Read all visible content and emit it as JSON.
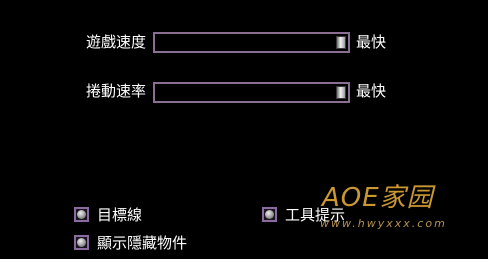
{
  "settings": {
    "game_speed": {
      "label": "遊戲速度",
      "value_label": "最快",
      "level": 1.0
    },
    "scroll_speed": {
      "label": "捲動速率",
      "value_label": "最快",
      "level": 1.0
    }
  },
  "options": {
    "target_line": {
      "label": "目標線"
    },
    "tooltips": {
      "label": "工具提示"
    },
    "show_hidden": {
      "label": "顯示隱藏物件"
    }
  },
  "watermark": {
    "brand": "AOE家园",
    "url": "www.hwyxxx.com"
  },
  "colors": {
    "background": "#000000",
    "slider_border": "#8a6f92",
    "radio_border": "#8b6aa0",
    "watermark": "#e0a838"
  }
}
